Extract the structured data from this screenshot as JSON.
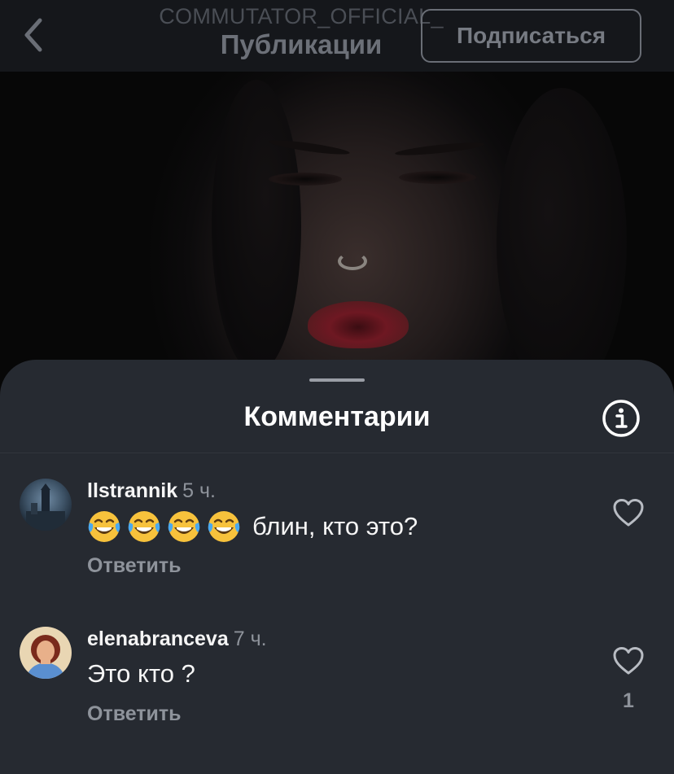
{
  "header": {
    "account_name": "COMMUTATOR_OFFICIAL_",
    "page_title": "Публикации",
    "subscribe_label": "Подписаться",
    "back_icon": "chevron-left-icon"
  },
  "sheet": {
    "title": "Комментарии",
    "info_icon": "info-icon"
  },
  "comments": [
    {
      "username": "llstrannik",
      "time": "5 ч.",
      "emojis": [
        "😂",
        "😂",
        "😂",
        "😂"
      ],
      "text": "блин, кто это?",
      "reply_label": "Ответить",
      "like_count": ""
    },
    {
      "username": "elenabranceva",
      "time": "7 ч.",
      "text": "Это кто ?",
      "reply_label": "Ответить",
      "like_count": "1"
    }
  ],
  "colors": {
    "sheet_bg": "#262a31",
    "secondary_text": "#8e939b",
    "primary_text": "#f5f5f5"
  }
}
